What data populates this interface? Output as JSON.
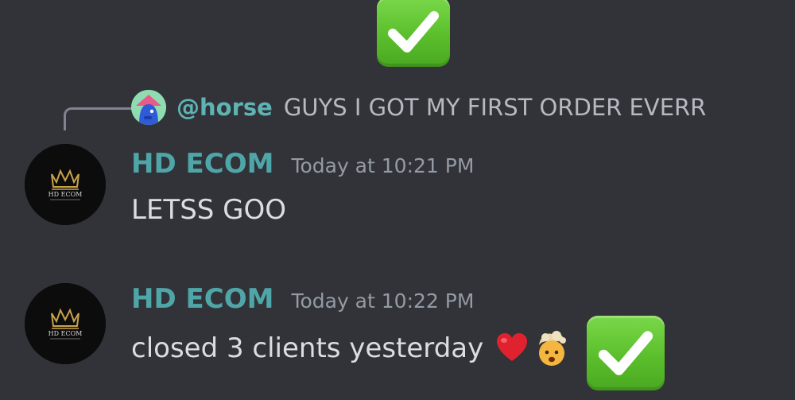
{
  "top_reaction": {
    "icon": "check-mark-button-icon",
    "color": "#5bbf2c"
  },
  "reply": {
    "mention": "@horse",
    "text": "GUYS I GOT MY FIRST ORDER EVERR",
    "avatar_icon": "horse-avatar-icon"
  },
  "messages": [
    {
      "username": "HD ECOM",
      "timestamp": "Today at 10:21 PM",
      "text": "LETSS GOO",
      "avatar_logo_text": "HD ECOM"
    },
    {
      "username": "HD ECOM",
      "timestamp": "Today at 10:22 PM",
      "text": "closed 3 clients yesterday",
      "avatar_logo_text": "HD ECOM",
      "emojis": [
        "red-heart-icon",
        "exploding-head-icon",
        "check-mark-button-icon"
      ]
    }
  ],
  "colors": {
    "background": "#313338",
    "username": "#4fa6a8",
    "mention": "#5eb3b4",
    "timestamp": "#949ba4",
    "message_text": "#dbdee1"
  }
}
